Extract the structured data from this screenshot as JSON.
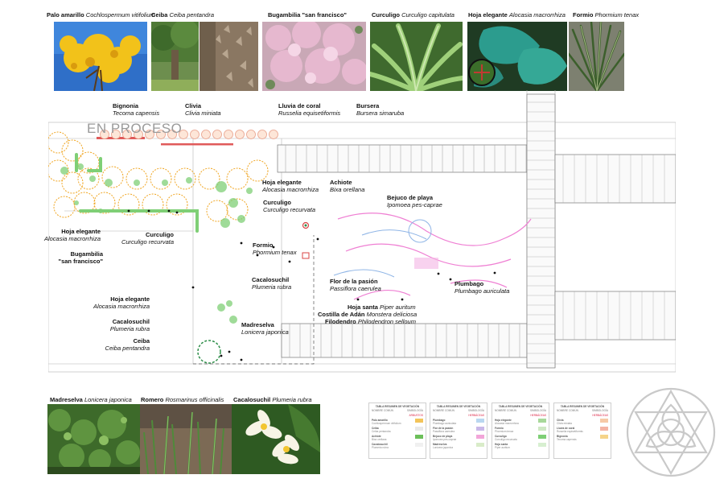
{
  "photos_top": [
    {
      "common": "Palo amarillo",
      "sci": "Cochlospermum vitifolium"
    },
    {
      "common": "Ceiba",
      "sci": "Ceiba pentandra"
    },
    {
      "common": "Bugambilia \"san francisco\"",
      "sci": ""
    },
    {
      "common": "Curculigo",
      "sci": "Curculigo capitulata"
    },
    {
      "common": "Hoja elegante",
      "sci": "Alocasia macrorrhiza"
    },
    {
      "common": "Formio",
      "sci": "Phormium tenax"
    }
  ],
  "photos_bottom": [
    {
      "common": "Madreselva",
      "sci": "Lonicera japonica"
    },
    {
      "common": "Romero",
      "sci": "Rosmarinus officinalis"
    },
    {
      "common": "Cacalosuchil",
      "sci": "Plumeria rubra"
    }
  ],
  "watermark": "EN PROCESO",
  "plan_labels": {
    "bignonia": {
      "common": "Bignonia",
      "sci": "Tecoma capensis"
    },
    "clivia": {
      "common": "Clivia",
      "sci": "Clivia miniata"
    },
    "lluvia": {
      "common": "Lluvia de coral",
      "sci": "Russelia equisetiformis"
    },
    "bursera": {
      "common": "Bursera",
      "sci": "Bursera simaruba"
    },
    "hoja1": {
      "common": "Hoja elegante",
      "sci": "Alocasia macrorrhiza"
    },
    "achiote": {
      "common": "Achiote",
      "sci": "Bixa orellana"
    },
    "bejuco": {
      "common": "Bejuco de playa",
      "sci": "Ipomoea pes-caprae"
    },
    "curculigo1": {
      "common": "Curculigo",
      "sci": "Curculigo recurvata"
    },
    "curculigo2": {
      "common": "Curculigo",
      "sci": "Curculigo recurvata"
    },
    "hoja2": {
      "common": "Hoja elegante",
      "sci": "Alocasia macrorrhiza"
    },
    "bug": {
      "common1": "Bugambilia",
      "common2": "\"san francisco\""
    },
    "formio": {
      "common": "Formio",
      "sci": "Phormium tenax"
    },
    "cacalo1": {
      "common": "Cacalosuchil",
      "sci": "Plumeria rubra"
    },
    "pasion": {
      "common": "Flor de la pasión",
      "sci": "Passiflora caerulea"
    },
    "plumbago": {
      "common": "Plumbago",
      "sci": "Plumbago auriculata"
    },
    "hoja3": {
      "common": "Hoja elegante",
      "sci": "Alocasia macrorrhiza"
    },
    "cacalo2": {
      "common": "Cacalosuchil",
      "sci": "Plumeria rubra"
    },
    "ceiba": {
      "common": "Ceiba",
      "sci": "Ceiba pentandra"
    },
    "madreselva": {
      "common": "Madreselva",
      "sci": "Lonicera japonica"
    },
    "hojasanta": {
      "common": "Hoja santa",
      "sci": "Piper auritum"
    },
    "costilla": {
      "common": "Costilla de Adán",
      "sci": "Monstera deliciosa"
    },
    "filodendro": {
      "common": "Filodendro",
      "sci": "Philodendron selloum"
    }
  },
  "legend_cards": [
    {
      "title": "TABLA RESUMEN DE VEGETACIÓN",
      "h1": "NOMBRE COMÚN",
      "h2": "SIMBOLOGÍA",
      "tag": "ARBUSTOS",
      "rows": [
        {
          "n": "Palo amarillo",
          "s": "Cochlospermum vitifolium",
          "color": "#f3c45a"
        },
        {
          "n": "Ceiba",
          "s": "Ceiba pentandra",
          "color": "#e9e9e9"
        },
        {
          "n": "Achiote",
          "s": "Bixa orellana",
          "color": "#6cbf5a"
        },
        {
          "n": "Cacalosuchil",
          "s": "Plumeria rubra",
          "color": "#f0f0f0"
        }
      ]
    },
    {
      "title": "TABLA RESUMEN DE VEGETACIÓN",
      "h1": "NOMBRE COMÚN",
      "h2": "SIMBOLOGÍA",
      "tag": "HERBÁCEAS",
      "rows": [
        {
          "n": "Plumbago",
          "s": "Plumbago auriculata",
          "color": "#b9d7f0"
        },
        {
          "n": "Flor de la pasión",
          "s": "Passiflora caerulea",
          "color": "#c9b8e8"
        },
        {
          "n": "Bejuco de playa",
          "s": "Ipomoea pes-caprae",
          "color": "#f2a6d9"
        },
        {
          "n": "Madreselva",
          "s": "Lonicera japonica",
          "color": "#d9ecc9"
        }
      ]
    },
    {
      "title": "TABLA RESUMEN DE VEGETACIÓN",
      "h1": "NOMBRE COMÚN",
      "h2": "SIMBOLOGÍA",
      "tag": "HERBÁCEAS",
      "rows": [
        {
          "n": "Hoja elegante",
          "s": "Alocasia macrorrhiza",
          "color": "#a8d89a"
        },
        {
          "n": "Formio",
          "s": "Phormium tenax",
          "color": "#cfe8c4"
        },
        {
          "n": "Curculigo",
          "s": "Curculigo recurvata",
          "color": "#7fcf76"
        },
        {
          "n": "Hoja santa",
          "s": "Piper auritum",
          "color": "#d7efd0"
        }
      ]
    },
    {
      "title": "TABLA RESUMEN DE VEGETACIÓN",
      "h1": "NOMBRE COMÚN",
      "h2": "SIMBOLOGÍA",
      "tag": "HERBÁCEAS",
      "rows": [
        {
          "n": "Clivia",
          "s": "Clivia miniata",
          "color": "#f6c9a6"
        },
        {
          "n": "Lluvia de coral",
          "s": "Russelia equisetiformis",
          "color": "#f4b3a4"
        },
        {
          "n": "Bignonia",
          "s": "Tecoma capensis",
          "color": "#f5d48a"
        }
      ]
    }
  ],
  "colors": {
    "tree_ring": "#f0a623",
    "planting": "#7fcf76",
    "path_pink": "#ef7fd3",
    "path_blue": "#8fb5e6",
    "line": "#8a8a8a",
    "red_strip": "#e05a5a"
  }
}
